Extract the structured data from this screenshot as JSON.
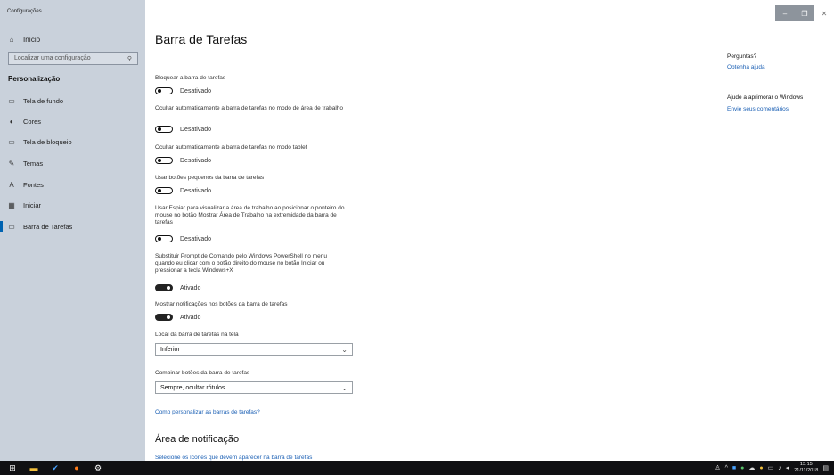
{
  "window": {
    "app_title": "Configurações",
    "minimize": "–",
    "maximize": "❐",
    "close": "✕"
  },
  "sidebar": {
    "home": "Início",
    "search_placeholder": "Localizar uma configuração",
    "section": "Personalização",
    "items": [
      {
        "label": "Tela de fundo",
        "icon": "image-icon"
      },
      {
        "label": "Cores",
        "icon": "palette-icon"
      },
      {
        "label": "Tela de bloqueio",
        "icon": "lock-screen-icon"
      },
      {
        "label": "Temas",
        "icon": "brush-icon"
      },
      {
        "label": "Fontes",
        "icon": "font-icon"
      },
      {
        "label": "Iniciar",
        "icon": "start-icon"
      },
      {
        "label": "Barra de Tarefas",
        "icon": "taskbar-icon",
        "active": true
      }
    ]
  },
  "main": {
    "title": "Barra de Tarefas",
    "settings": [
      {
        "label": "Bloquear a barra de tarefas",
        "state": "Desativado"
      },
      {
        "label": "Ocultar automaticamente a barra de tarefas no modo de área de trabalho",
        "state": "Desativado"
      },
      {
        "label": "Ocultar automaticamente a barra de tarefas no modo tablet",
        "state": "Desativado"
      },
      {
        "label": "Usar botões pequenos da barra de tarefas",
        "state": "Desativado"
      },
      {
        "label": "Usar Espiar para visualizar a área de trabalho ao posicionar o ponteiro do mouse no botão Mostrar Área de Trabalho na extremidade da barra de tarefas",
        "state": "Desativado"
      },
      {
        "label": "Substituir Prompt de Comando pelo Windows PowerShell no menu quando eu clicar com o botão direito do mouse no botão Iniciar ou pressionar a tecla Windows+X",
        "state": "Ativado"
      },
      {
        "label": "Mostrar notificações nos botões da barra de tarefas",
        "state": "Ativado"
      }
    ],
    "location_label": "Local da barra de tarefas na tela",
    "location_value": "Inferior",
    "combine_label": "Combinar botões da barra de tarefas",
    "combine_value": "Sempre, ocultar rótulos",
    "help_link": "Como personalizar as barras de tarefas?",
    "notification_title": "Área de notificação",
    "notification_link": "Selecione os ícones que devem aparecer na barra de tarefas"
  },
  "right": {
    "questions_title": "Perguntas?",
    "help_link": "Obtenha ajuda",
    "improve_title": "Ajude a aprimorar o Windows",
    "feedback_link": "Envie seus comentários"
  },
  "taskbar": {
    "time": "13:15",
    "date": "21/11/2018",
    "colors": {
      "firefox": "#ff7a18",
      "folder": "#f3c03c"
    }
  }
}
